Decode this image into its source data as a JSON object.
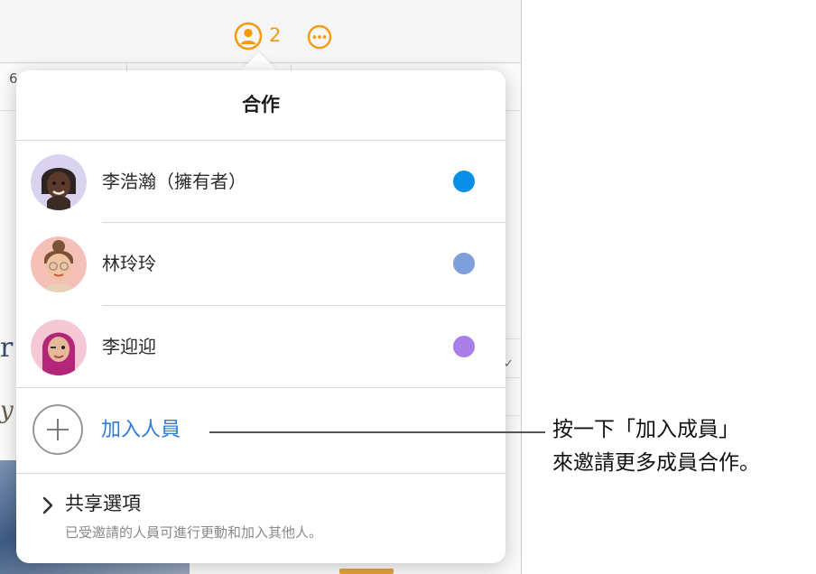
{
  "toolbar": {
    "collaborator_count": "2",
    "collab_icon": "person-circle-icon",
    "more_icon": "ellipsis-circle-icon",
    "accent": "#f39c12"
  },
  "background_fragments": {
    "tick_label": "6",
    "letter_r": "r",
    "letter_y": "y",
    "checkmark": "✓"
  },
  "popover": {
    "title": "合作",
    "participants": [
      {
        "name": "李浩瀚（擁有者）",
        "color": "#0a8fe8",
        "avatar_icon": "memoji-avatar-icon"
      },
      {
        "name": "林玲玲",
        "color": "#7f9fda",
        "avatar_icon": "memoji-avatar-icon"
      },
      {
        "name": "李迎迎",
        "color": "#a97ee6",
        "avatar_icon": "memoji-avatar-icon"
      }
    ],
    "add_people": {
      "label": "加入人員",
      "icon": "plus-circle-icon",
      "color": "#2f7bd8"
    },
    "share_options": {
      "title": "共享選項",
      "subtitle": "已受邀請的人員可進行更動和加入其他人。",
      "icon": "chevron-right-icon"
    }
  },
  "callout": {
    "line1": "按一下「加入成員」",
    "line2": "來邀請更多成員合作。"
  }
}
